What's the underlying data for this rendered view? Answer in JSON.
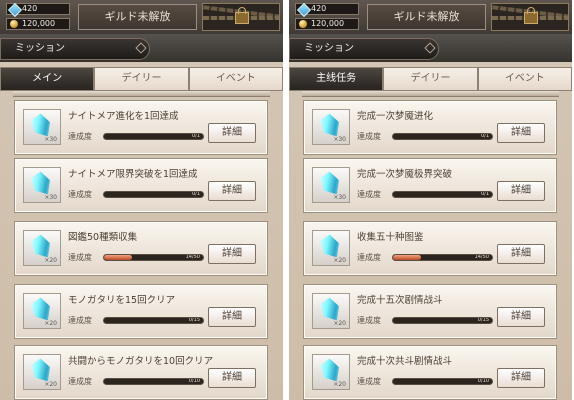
{
  "left": {
    "resources": [
      "420",
      "120,000"
    ],
    "guild_label": "ギルド未解放",
    "section_title": "ミッション",
    "tabs": [
      {
        "label": "メイン",
        "active": true
      },
      {
        "label": "デイリー",
        "active": false
      },
      {
        "label": "イベント",
        "active": false
      }
    ],
    "progress_label": "達成度",
    "detail_label": "詳細",
    "missions": [
      {
        "title": "ナイトメア進化を1回達成",
        "reward_qty": "×30",
        "progress": "0/1",
        "fill": 0
      },
      {
        "title": "ナイトメア限界突破を1回達成",
        "reward_qty": "×30",
        "progress": "0/1",
        "fill": 0
      },
      {
        "title": "図鑑50種類収集",
        "reward_qty": "×20",
        "progress": "14/50",
        "fill": 0.28
      },
      {
        "title": "モノガタリを15回クリア",
        "reward_qty": "×20",
        "progress": "0/15",
        "fill": 0
      },
      {
        "title": "共闘からモノガタリを10回クリア",
        "reward_qty": "×20",
        "progress": "0/10",
        "fill": 0
      }
    ]
  },
  "right": {
    "resources": [
      "420",
      "120,000"
    ],
    "guild_label": "ギルド未解放",
    "section_title": "ミッション",
    "tabs": [
      {
        "label": "主线任务",
        "active": true
      },
      {
        "label": "デイリー",
        "active": false
      },
      {
        "label": "イベント",
        "active": false
      }
    ],
    "progress_label": "達成度",
    "detail_label": "詳細",
    "missions": [
      {
        "title": "完成一次梦魇进化",
        "reward_qty": "×30",
        "progress": "0/1",
        "fill": 0
      },
      {
        "title": "完成一次梦魇极界突破",
        "reward_qty": "×30",
        "progress": "0/1",
        "fill": 0
      },
      {
        "title": "收集五十种图鉴",
        "reward_qty": "×20",
        "progress": "14/50",
        "fill": 0.28
      },
      {
        "title": "完成十五次剧情战斗",
        "reward_qty": "×20",
        "progress": "0/15",
        "fill": 0
      },
      {
        "title": "完成十次共斗剧情战斗",
        "reward_qty": "×20",
        "progress": "0/10",
        "fill": 0
      }
    ]
  },
  "colors": {
    "accent": "#b84a28",
    "dark_header": "#36322e",
    "card_bg": "#faf6ef"
  },
  "icons": {
    "gem": "gem-icon",
    "coin": "coin-icon",
    "lock": "lock-icon",
    "reward": "crystal-icon"
  }
}
